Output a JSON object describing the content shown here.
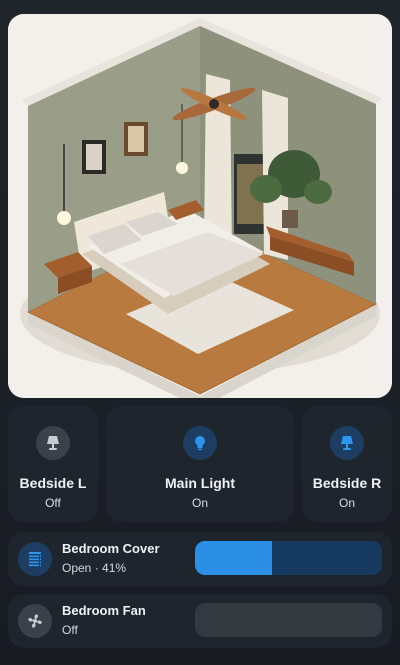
{
  "room": {
    "image_alt": "isometric bedroom illustration"
  },
  "tiles": [
    {
      "name": "Bedside L",
      "state": "Off",
      "icon": "bedside-lamp-icon",
      "active": false
    },
    {
      "name": "Main Light",
      "state": "On",
      "icon": "lightbulb-icon",
      "active": true
    },
    {
      "name": "Bedside R",
      "state": "On",
      "icon": "bedside-lamp-icon",
      "active": true
    }
  ],
  "cover": {
    "name": "Bedroom Cover",
    "state": "Open · 41%",
    "position": 41,
    "icon": "blinds-icon"
  },
  "fan": {
    "name": "Bedroom Fan",
    "state": "Off",
    "speed": 0,
    "icon": "fan-icon"
  },
  "colors": {
    "accent": "#2b8fe6",
    "accent_dark": "#173a60",
    "off": "#3b4148",
    "card": "#1f252c"
  }
}
